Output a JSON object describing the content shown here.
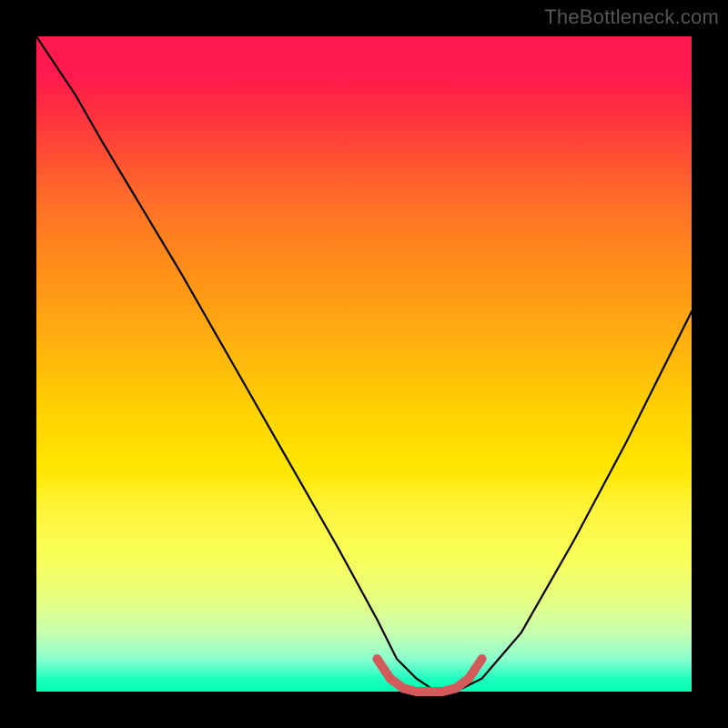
{
  "watermark": "TheBottleneck.com",
  "chart_data": {
    "type": "line",
    "title": "",
    "xlabel": "",
    "ylabel": "",
    "xlim": [
      0,
      100
    ],
    "ylim": [
      0,
      100
    ],
    "grid": false,
    "legend": false,
    "series": [
      {
        "name": "bottleneck-curve",
        "color": "#000000",
        "x": [
          0,
          2,
          6,
          10,
          16,
          22,
          30,
          38,
          46,
          52,
          55,
          58,
          61,
          64,
          68,
          74,
          82,
          90,
          100
        ],
        "y": [
          100,
          97,
          91,
          84,
          74,
          64,
          50,
          36,
          22,
          11,
          5,
          2,
          0,
          0,
          2,
          9,
          23,
          38,
          58
        ]
      },
      {
        "name": "optimal-bracket",
        "color": "#d15a5a",
        "x": [
          52,
          54,
          56,
          58,
          60,
          62,
          64,
          66,
          68
        ],
        "y": [
          5,
          2,
          0.5,
          0,
          0,
          0,
          0.5,
          2,
          5
        ]
      }
    ],
    "annotations": []
  }
}
